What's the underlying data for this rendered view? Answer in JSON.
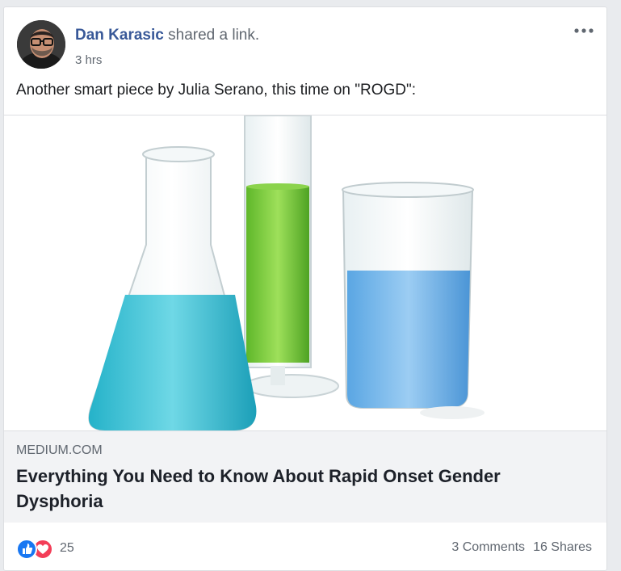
{
  "post": {
    "author": "Dan Karasic",
    "action": "shared a link.",
    "time": "3 hrs",
    "message": "Another smart piece by Julia Serano, this time on \"ROGD\":",
    "more_icon": "ellipsis-icon"
  },
  "link": {
    "domain": "MEDIUM.COM",
    "title": "Everything You Need to Know About Rapid Onset Gender Dysphoria"
  },
  "footer": {
    "reaction_count": "25",
    "comments": "3 Comments",
    "shares": "16 Shares"
  },
  "colors": {
    "author_link": "#385898",
    "like_blue": "#1877f2",
    "love_red": "#f33e58"
  }
}
